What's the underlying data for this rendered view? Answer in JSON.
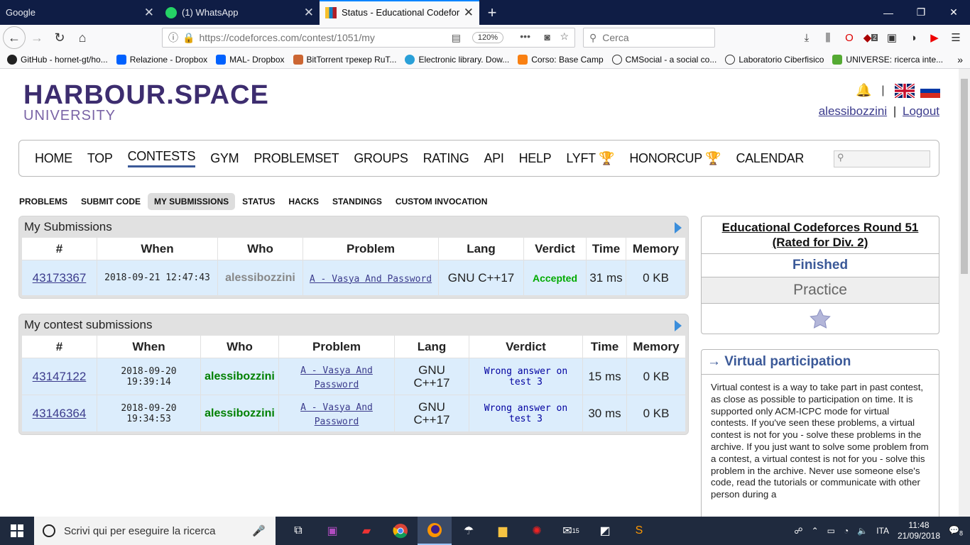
{
  "browser": {
    "tabs": [
      {
        "title": "Google",
        "active": false
      },
      {
        "title": "(1) WhatsApp",
        "active": false
      },
      {
        "title": "Status - Educational Codeforce",
        "active": true
      }
    ],
    "url": "https://codeforces.com/contest/1051/my",
    "zoom": "120%",
    "search_placeholder": "Cerca",
    "bookmarks": [
      "GitHub - hornet-gt/ho...",
      "Relazione - Dropbox",
      "MAL- Dropbox",
      "BitTorrent трекер RuT...",
      "Electronic library. Dow...",
      "Corso: Base Camp",
      "CMSocial - a social co...",
      "Laboratorio Ciberfisico",
      "UNIVERSE: ricerca inte..."
    ],
    "badge_count": "2"
  },
  "site": {
    "logo_line1": "HARBOUR.SPACE",
    "logo_line2": "UNIVERSITY",
    "username": "alessibozzini",
    "separator": "|",
    "logout": "Logout",
    "menu": [
      "HOME",
      "TOP",
      "CONTESTS",
      "GYM",
      "PROBLEMSET",
      "GROUPS",
      "RATING",
      "API",
      "HELP",
      "LYFT 🏆",
      "HONORCUP 🏆",
      "CALENDAR"
    ],
    "submenu": [
      "PROBLEMS",
      "SUBMIT CODE",
      "MY SUBMISSIONS",
      "STATUS",
      "HACKS",
      "STANDINGS",
      "CUSTOM INVOCATION"
    ]
  },
  "my_submissions": {
    "caption": "My Submissions",
    "headers": [
      "#",
      "When",
      "Who",
      "Problem",
      "Lang",
      "Verdict",
      "Time",
      "Memory"
    ],
    "rows": [
      {
        "id": "43173367",
        "when": "2018-09-21 12:47:43",
        "who": "alessibozzini",
        "problem": "A - Vasya And Password",
        "lang": "GNU C++17",
        "verdict": "Accepted",
        "time": "31 ms",
        "memory": "0 KB"
      }
    ]
  },
  "contest_submissions": {
    "caption": "My contest submissions",
    "headers": [
      "#",
      "When",
      "Who",
      "Problem",
      "Lang",
      "Verdict",
      "Time",
      "Memory"
    ],
    "rows": [
      {
        "id": "43147122",
        "when": "2018-09-20 19:39:14",
        "who": "alessibozzini",
        "problem": "A - Vasya And Password",
        "lang": "GNU C++17",
        "verdict": "Wrong answer on test 3",
        "time": "15 ms",
        "memory": "0 KB"
      },
      {
        "id": "43146364",
        "when": "2018-09-20 19:34:53",
        "who": "alessibozzini",
        "problem": "A - Vasya And Password",
        "lang": "GNU C++17",
        "verdict": "Wrong answer on test 3",
        "time": "30 ms",
        "memory": "0 KB"
      }
    ]
  },
  "sidebar": {
    "contest_title": "Educational Codeforces Round 51 (Rated for Div. 2)",
    "status": "Finished",
    "practice": "Practice",
    "virtual_title": "→ Virtual participation",
    "virtual_text": "Virtual contest is a way to take part in past contest, as close as possible to participation on time. It is supported only ACM-ICPC mode for virtual contests. If you've seen these problems, a virtual contest is not for you - solve these problems in the archive. If you just want to solve some problem from a contest, a virtual contest is not for you - solve this problem in the archive. Never use someone else's code, read the tutorials or communicate with other person during a"
  },
  "taskbar": {
    "search_text": "Scrivi qui per eseguire la ricerca",
    "language": "ITA",
    "time": "11:48",
    "date": "21/09/2018",
    "mail_count": "15",
    "notif_count": "8"
  }
}
